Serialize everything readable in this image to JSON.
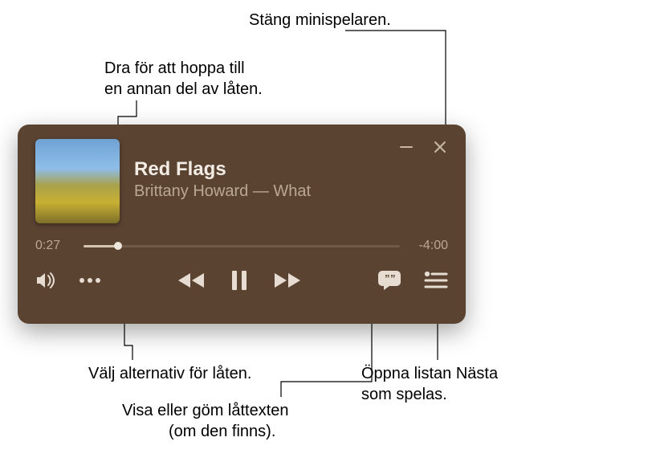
{
  "callouts": {
    "close": "Stäng minispelaren.",
    "scrub_l1": "Dra för att hoppa till",
    "scrub_l2": "en annan del av låten.",
    "more": "Välj alternativ för låten.",
    "lyrics_l1": "Visa eller göm låttexten",
    "lyrics_l2": "(om den finns).",
    "queue_l1": "Öppna listan Nästa",
    "queue_l2": "som spelas."
  },
  "player": {
    "song_title": "Red Flags",
    "artist_line": "Brittany Howard — What",
    "elapsed": "0:27",
    "remaining": "-4:00"
  },
  "icons": {
    "minimize": "minimize-icon",
    "close": "close-icon",
    "volume": "volume-icon",
    "more": "more-icon",
    "rewind": "rewind-icon",
    "pause": "pause-icon",
    "forward": "forward-icon",
    "lyrics": "lyrics-icon",
    "queue": "queue-icon"
  }
}
